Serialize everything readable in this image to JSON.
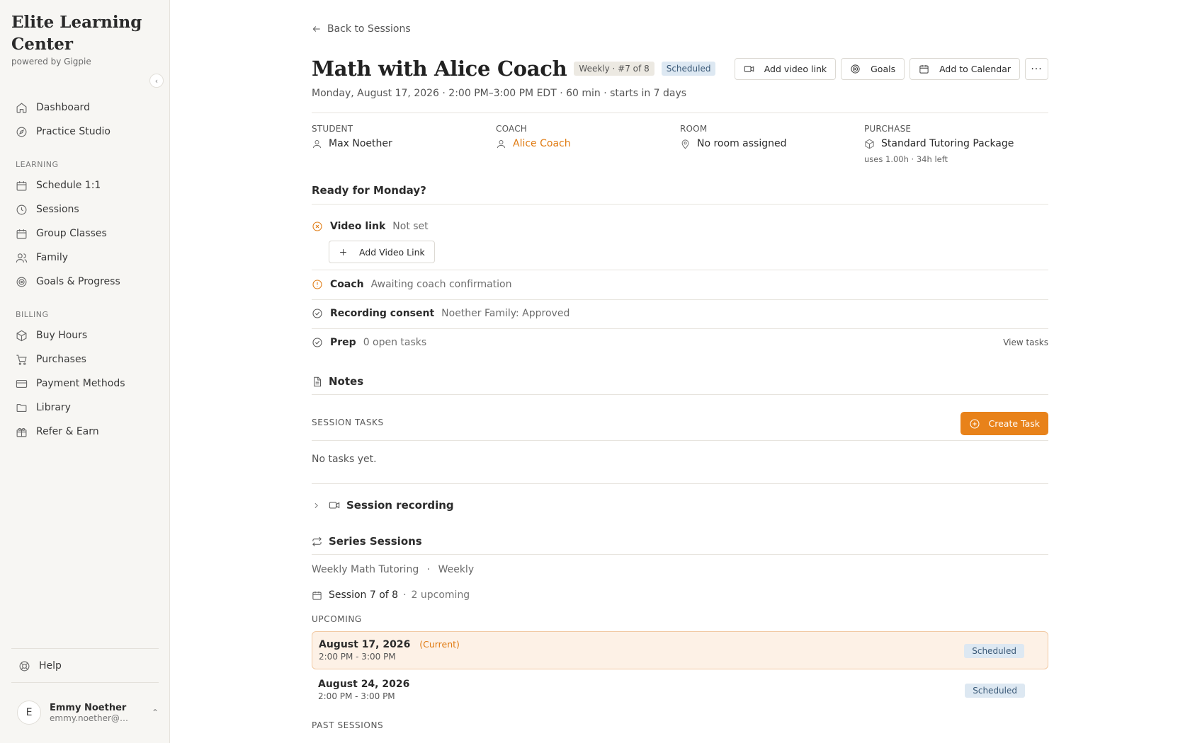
{
  "sidebar": {
    "brand_title": "Elite Learning Center",
    "brand_sub": "powered by Gigpie",
    "items_top": [
      {
        "label": "Dashboard",
        "icon": "home-icon"
      },
      {
        "label": "Practice Studio",
        "icon": "compass-icon"
      }
    ],
    "learning_label": "LEARNING",
    "items_learning": [
      {
        "label": "Schedule 1:1",
        "icon": "calendar-icon"
      },
      {
        "label": "Sessions",
        "icon": "clock-icon"
      },
      {
        "label": "Group Classes",
        "icon": "calendar-icon"
      },
      {
        "label": "Family",
        "icon": "users-icon"
      },
      {
        "label": "Goals & Progress",
        "icon": "target-icon"
      }
    ],
    "billing_label": "BILLING",
    "items_billing": [
      {
        "label": "Buy Hours",
        "icon": "package-icon"
      },
      {
        "label": "Purchases",
        "icon": "cart-icon"
      },
      {
        "label": "Payment Methods",
        "icon": "credit-card-icon"
      },
      {
        "label": "Library",
        "icon": "folder-icon"
      },
      {
        "label": "Refer & Earn",
        "icon": "gift-icon"
      }
    ],
    "help": "Help",
    "user": {
      "initial": "E",
      "name": "Emmy Noether",
      "email": "emmy.noether@ex..."
    }
  },
  "header": {
    "back": "Back to Sessions",
    "title": "Math with Alice Coach",
    "series_badge": "Weekly · #7 of 8",
    "status_badge": "Scheduled",
    "subtitle": "Monday, August 17, 2026 · 2:00 PM–3:00 PM EDT · 60 min · starts in 7 days",
    "actions": {
      "video": "Add video link",
      "goals": "Goals",
      "calendar": "Add to Calendar",
      "more": "···"
    }
  },
  "meta": {
    "student_label": "STUDENT",
    "student": "Max Noether",
    "coach_label": "COACH",
    "coach": "Alice Coach",
    "room_label": "ROOM",
    "room": "No room assigned",
    "purchase_label": "PURCHASE",
    "purchase": "Standard Tutoring Package",
    "purchase_sub": "uses 1.00h · 34h left"
  },
  "readiness": {
    "title": "Ready for Monday?",
    "video_label": "Video link",
    "video_detail": "Not set",
    "add_video": "Add Video Link",
    "coach_label": "Coach",
    "coach_detail": "Awaiting coach confirmation",
    "consent_label": "Recording consent",
    "consent_detail": "Noether Family: Approved",
    "prep_label": "Prep",
    "prep_detail": "0 open tasks",
    "view_tasks": "View tasks"
  },
  "notes": {
    "title": "Notes"
  },
  "tasks": {
    "label": "SESSION TASKS",
    "create": "Create Task",
    "empty": "No tasks yet."
  },
  "recording": {
    "title": "Session recording"
  },
  "series": {
    "title": "Series Sessions",
    "name": "Weekly Math Tutoring",
    "sep": "·",
    "freq": "Weekly",
    "count": "Session 7 of 8",
    "upcoming_count": "2 upcoming",
    "upcoming_label": "UPCOMING",
    "sessions": [
      {
        "date": "August 17, 2026",
        "current": "(Current)",
        "time": "2:00 PM - 3:00 PM",
        "status": "Scheduled"
      },
      {
        "date": "August 24, 2026",
        "current": "",
        "time": "2:00 PM - 3:00 PM",
        "status": "Scheduled"
      }
    ],
    "past_label": "PAST SESSIONS"
  },
  "colors": {
    "accent": "#e8821a",
    "status_bg": "#dde8f2",
    "current_bg": "#fdf1e6"
  }
}
